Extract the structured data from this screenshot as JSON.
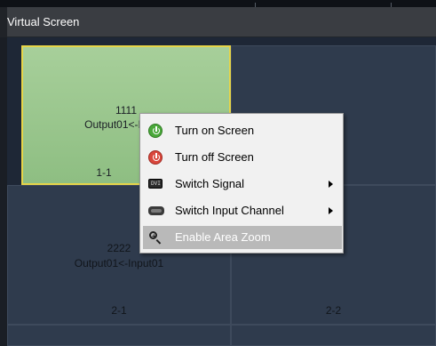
{
  "window": {
    "title": "Virtual Screen"
  },
  "screens": [
    {
      "name": "1111",
      "source": "Output01<-I",
      "position": "1-1",
      "selected": true
    },
    {
      "name": "",
      "source": "",
      "position": "",
      "selected": false
    },
    {
      "name": "2222",
      "source": "Output01<-Input01",
      "position": "2-1",
      "selected": false
    },
    {
      "name": "",
      "source": "",
      "position": "2-2",
      "selected": false
    }
  ],
  "context_menu": {
    "items": [
      {
        "label": "Turn on Screen",
        "icon": "power-on-icon",
        "has_submenu": false,
        "highlighted": false
      },
      {
        "label": "Turn off Screen",
        "icon": "power-off-icon",
        "has_submenu": false,
        "highlighted": false
      },
      {
        "label": "Switch Signal",
        "icon": "dvi-signal-icon",
        "has_submenu": true,
        "highlighted": false
      },
      {
        "label": "Switch Input Channel",
        "icon": "input-channel-icon",
        "has_submenu": true,
        "highlighted": false
      },
      {
        "label": "Enable Area Zoom",
        "icon": "zoom-icon",
        "has_submenu": false,
        "highlighted": true
      }
    ],
    "signal_icon_text": "DVI"
  },
  "colors": {
    "selected_fill": "#9fca91",
    "selected_border": "#e6d54a",
    "cell_fill": "#2f3b4d",
    "menu_highlight": "#b9b9b9"
  }
}
